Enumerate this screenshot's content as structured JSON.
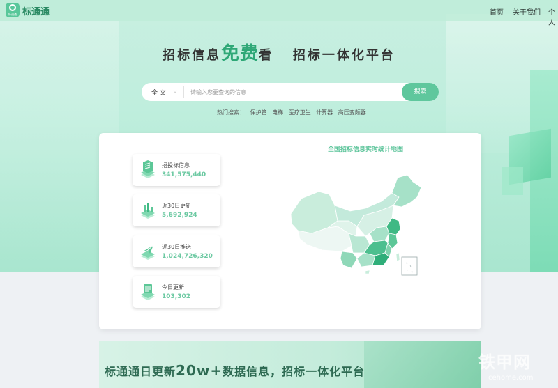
{
  "nav": {
    "logo_text": "标通通",
    "logo_badge_text": "标通通",
    "links": [
      "首页",
      "关于我们",
      "个人"
    ]
  },
  "hero": {
    "title_part1": "招标信息",
    "title_accent": "免费",
    "title_part2": "看   招标一体化平台"
  },
  "search": {
    "scope": "全 文",
    "placeholder": "请输入您要查询的信息",
    "button": "搜索"
  },
  "hot": {
    "label": "热门搜索：",
    "terms": [
      "保护管",
      "电梯",
      "医疗卫生",
      "计算器",
      "高压变频器"
    ]
  },
  "stats": [
    {
      "label": "招投标信息",
      "value": "341,575,440"
    },
    {
      "label": "近30日更新",
      "value": "5,692,924"
    },
    {
      "label": "近30日推送",
      "value": "1,024,726,320"
    },
    {
      "label": "今日更新",
      "value": "103,302"
    }
  ],
  "map": {
    "title": "全国招标信息实时统计地图",
    "colors": {
      "light": "#e4f5ee",
      "mid": "#a9e2cb",
      "dark": "#4dbf8f",
      "darker": "#2fae79"
    }
  },
  "banner": {
    "text_part1": "标通通日更新",
    "text_big": "20w+",
    "text_part2": "数据信息，招标一体化平台"
  },
  "watermark": {
    "text": "铁甲网",
    "sub": "cehome.com"
  }
}
